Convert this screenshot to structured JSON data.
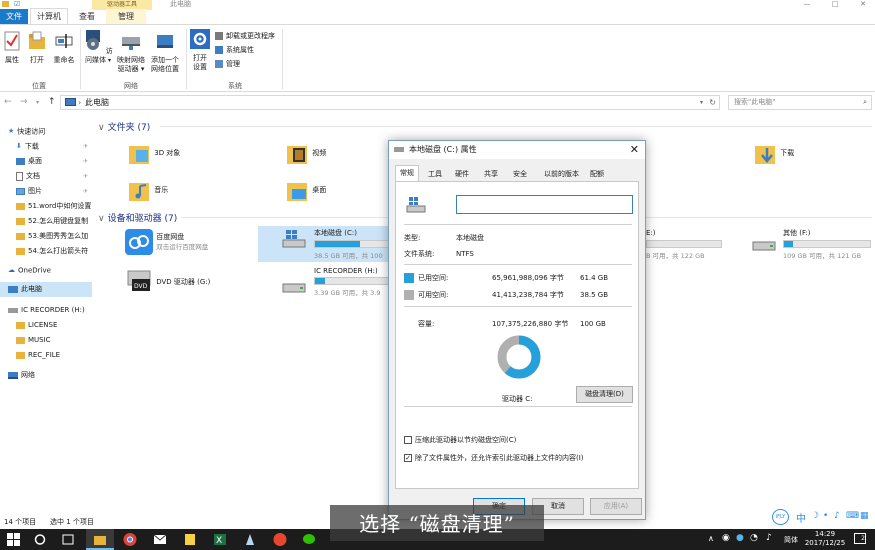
{
  "window": {
    "context_tab": "驱动器工具",
    "title": "此电脑",
    "controls": {
      "minimize": "—",
      "maximize": "□",
      "close": "✕"
    }
  },
  "tabs": {
    "file": "文件",
    "computer": "计算机",
    "view": "查看",
    "manage": "管理"
  },
  "ribbon": {
    "location": {
      "label": "位置",
      "properties": "属性",
      "open": "打开",
      "rename": "重命名"
    },
    "network": {
      "label": "网络",
      "access_media": "访问媒体",
      "map_drive_1": "映射网络",
      "map_drive_2": "驱动器 ▾",
      "add_location_1": "添加一个",
      "add_location_2": "网络位置"
    },
    "system": {
      "label": "系统",
      "open_settings_1": "打开",
      "open_settings_2": "设置",
      "uninstall": "卸载或更改程序",
      "sys_props": "系统属性",
      "manage": "管理"
    }
  },
  "address": {
    "path": "此电脑",
    "search_placeholder": "搜索\"此电脑\""
  },
  "nav": {
    "quick_access": "快速访问",
    "downloads": "下载",
    "desktop": "桌面",
    "documents": "文档",
    "pictures": "图片",
    "recent1": "51.word中如何设置",
    "recent2": "52.怎么用键盘复制",
    "recent3": "53.美图秀秀怎么加",
    "recent4": "54.怎么打出箭头符",
    "onedrive": "OneDrive",
    "this_pc": "此电脑",
    "ic_recorder": "IC RECORDER (H:)",
    "license": "LICENSE",
    "music": "MUSIC",
    "rec_file": "REC_FILE",
    "network": "网络"
  },
  "content": {
    "folders_header": "文件夹 (7)",
    "folders": {
      "objects3d": "3D 对象",
      "videos": "视频",
      "music": "音乐",
      "desktop": "桌面",
      "downloads": "下载"
    },
    "devices_header": "设备和驱动器 (7)",
    "baidu": {
      "name": "百度网盘",
      "sub": "双击运行百度网盘"
    },
    "dvd": "DVD 驱动器 (G:)",
    "drive_c": {
      "name": "本地磁盘 (C:)",
      "sub": "38.5 GB 可用，共 100"
    },
    "drive_h": {
      "name": "IC RECORDER (H:)",
      "sub": "3.39 GB 可用，共 3.9"
    },
    "drive_e": {
      "name": "E:)",
      "sub": "B 可用，共 122 GB"
    },
    "drive_f": {
      "name": "其他 (F:)",
      "sub": "109 GB 可用，共 121 GB"
    }
  },
  "dialog": {
    "title": "本地磁盘 (C:) 属性",
    "tabs": [
      "常规",
      "工具",
      "硬件",
      "共享",
      "安全",
      "以前的版本",
      "配额"
    ],
    "name_value": "",
    "type_label": "类型:",
    "type_value": "本地磁盘",
    "fs_label": "文件系统:",
    "fs_value": "NTFS",
    "used_label": "已用空间:",
    "used_bytes": "65,961,988,096 字节",
    "used_gb": "61.4 GB",
    "free_label": "可用空间:",
    "free_bytes": "41,413,238,784 字节",
    "free_gb": "38.5 GB",
    "cap_label": "容量:",
    "cap_bytes": "107,375,226,880 字节",
    "cap_gb": "100 GB",
    "used_fraction": 0.614,
    "drive_label": "驱动器 C:",
    "cleanup_button": "磁盘清理(D)",
    "compress_label": "压缩此驱动器以节约磁盘空间(C)",
    "compress_checked": false,
    "index_label": "除了文件属性外，还允许索引此驱动器上文件的内容(I)",
    "index_checked": true,
    "ok": "确定",
    "cancel": "取消",
    "apply": "应用(A)",
    "colors": {
      "used": "#26a0da",
      "free": "#b0b0b0"
    }
  },
  "status": {
    "items": "14 个项目",
    "selected": "选中 1 个项目"
  },
  "subtitle": "选择 “磁盘清理”",
  "taskbar": {
    "time": "14:29",
    "date": "2017/12/25",
    "lang": "简体",
    "ime": "中",
    "notif_count": "2",
    "iflytek": "iFLY"
  }
}
